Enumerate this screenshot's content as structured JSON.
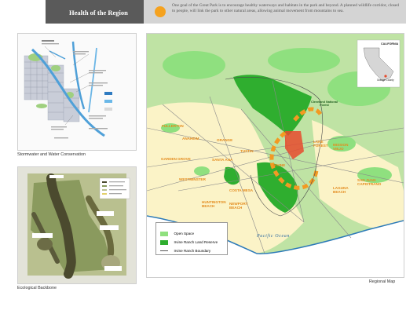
{
  "header": {
    "title": "Health of the Region",
    "description": "One goal of the Great Park is to encourage healthy waterways and habitats in the park and beyond. A planned wildlife corridor, closed to people, will link the park to other natural areas, allowing animal movement from mountains to sea.",
    "dot_color": "#f5a21f"
  },
  "stormwater": {
    "caption": "Stormwater and Water Conservation"
  },
  "backbone": {
    "caption": "Ecological Backbone"
  },
  "regional_map": {
    "caption": "Regional Map",
    "ocean_label": "Pacific Ocean",
    "legend": [
      {
        "label": "Open Space",
        "color": "#8fe07f"
      },
      {
        "label": "Irvine Ranch Land Reserve",
        "color": "#2fae2f"
      },
      {
        "label": "Irvine Ranch Boundary",
        "color": "#555555"
      }
    ],
    "city_labels": [
      "FULLERTON",
      "ANAHEIM",
      "ORANGE",
      "GARDEN GROVE",
      "SANTA ANA",
      "TUSTIN",
      "WESTMINSTER",
      "COSTA MESA",
      "HUNTINGTON BEACH",
      "NEWPORT BEACH",
      "IRVINE",
      "LAKE FOREST",
      "MISSION VIEJO",
      "LAGUNA BEACH",
      "SAN JUAN CAPISTRANO"
    ],
    "forest_label": "Cleveland National Forest",
    "inset": {
      "state_label": "CALIFORNIA",
      "county_label": "Orange County"
    }
  }
}
